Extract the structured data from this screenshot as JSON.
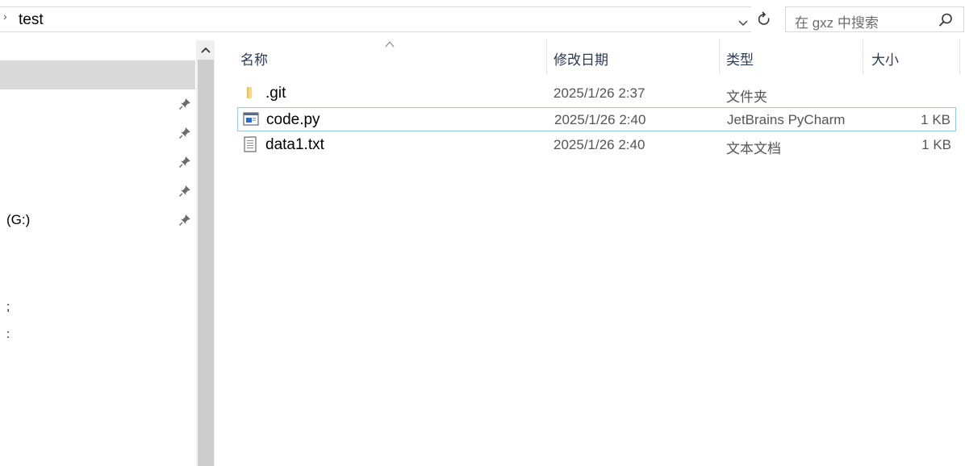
{
  "address": {
    "path_text": "test",
    "breadcrumb_arrow": "›"
  },
  "search": {
    "placeholder": "在 gxz 中搜索"
  },
  "nav": {
    "drive_fragment": "(G:)",
    "fragment_a": ";",
    "fragment_b": ":"
  },
  "columns": {
    "name": "名称",
    "date": "修改日期",
    "type": "类型",
    "size": "大小"
  },
  "files": [
    {
      "name": ".git",
      "date": "2025/1/26 2:37",
      "type": "文件夹",
      "size": "",
      "icon": "folder-icon"
    },
    {
      "name": "code.py",
      "date": "2025/1/26 2:40",
      "type": "JetBrains PyCharm",
      "size": "1 KB",
      "icon": "pycharm-file-icon",
      "selected": true
    },
    {
      "name": "data1.txt",
      "date": "2025/1/26 2:40",
      "type": "文本文档",
      "size": "1 KB",
      "icon": "text-file-icon"
    }
  ],
  "colors": {
    "selection_border": "#99c9ef",
    "nav_selected_bg": "#d9d9d9",
    "header_text": "#2b3a55"
  }
}
